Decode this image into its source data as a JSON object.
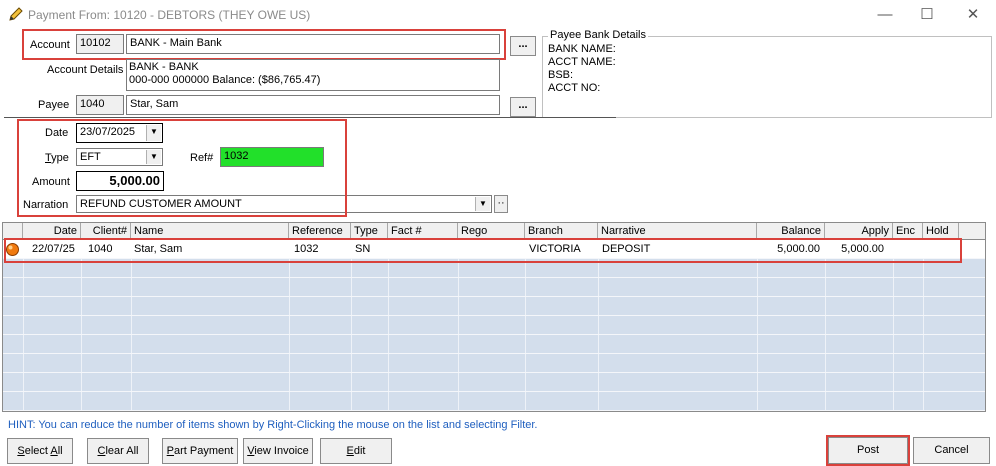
{
  "window": {
    "title": "Payment From: 10120 - DEBTORS (THEY OWE US)"
  },
  "account": {
    "label": "Account",
    "code": "10102",
    "name": "BANK - Main Bank",
    "browse_label": "..."
  },
  "account_details": {
    "label": "Account Details",
    "line1": "BANK - BANK",
    "line2": "000-000 000000   Balance: ($86,765.47)"
  },
  "payee": {
    "label": "Payee",
    "code": "1040",
    "name": "Star, Sam",
    "browse_label": "..."
  },
  "payee_bank": {
    "title": "Payee Bank Details",
    "bank_name_label": "BANK NAME:",
    "acct_name_label": "ACCT NAME:",
    "bsb_label": "BSB:",
    "acct_no_label": "ACCT NO:"
  },
  "form": {
    "date_label": "Date",
    "date_value": "23/07/2025",
    "type_label": "Type",
    "type_value": "EFT",
    "ref_label": "Ref#",
    "ref_value": "1032",
    "amount_label": "Amount",
    "amount_value": "5,000.00",
    "narration_label": "Narration",
    "narration_value": "REFUND CUSTOMER AMOUNT",
    "narration_extra": "··"
  },
  "colors": {
    "ref_bg": "#22e02a",
    "highlight": "#d9413b",
    "grid_bg": "#d3deec",
    "hint": "#1f5fbf"
  },
  "grid": {
    "headers": [
      "Date",
      "Client#",
      "Name",
      "Reference",
      "Type",
      "Fact #",
      "Rego",
      "Branch",
      "Narrative",
      "Balance",
      "Apply",
      "Enc",
      "Hold"
    ],
    "rows": [
      {
        "status_icon": "orange-circle-icon",
        "date": "22/07/25",
        "client": "1040",
        "name": "Star, Sam",
        "reference": "1032",
        "type": "SN",
        "fact": "",
        "rego": "",
        "branch": "VICTORIA",
        "narrative": "DEPOSIT",
        "balance": "5,000.00",
        "apply": "5,000.00",
        "enc": "",
        "hold": ""
      }
    ]
  },
  "hint": "HINT: You can reduce the number of items shown by Right-Clicking the mouse on the list and selecting Filter.",
  "buttons": {
    "select_all": "Select All",
    "clear_all": "Clear All",
    "part_payment": "Part Payment",
    "view_invoice": "View Invoice",
    "edit": "Edit",
    "post": "Post",
    "cancel": "Cancel"
  }
}
